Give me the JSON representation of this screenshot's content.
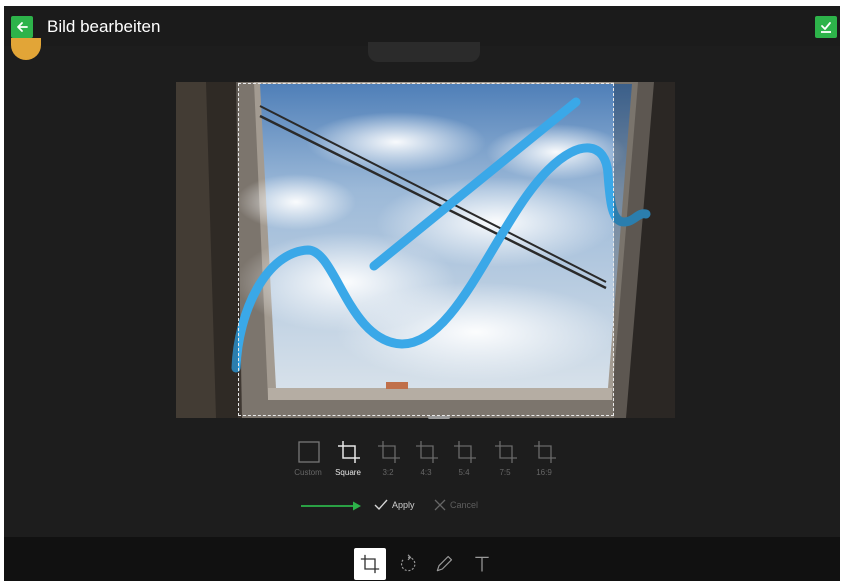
{
  "header": {
    "title": "Bild bearbeiten",
    "back_icon": "arrow-left-icon",
    "save_icon": "check-download-icon",
    "accent_color": "#2db34a"
  },
  "crop": {
    "ratios": [
      {
        "label": "Custom",
        "icon": "square-outline-icon",
        "active": false
      },
      {
        "label": "Square",
        "icon": "crop-icon",
        "active": true
      },
      {
        "label": "3:2",
        "icon": "crop-icon",
        "active": false
      },
      {
        "label": "4:3",
        "icon": "crop-icon",
        "active": false
      },
      {
        "label": "5:4",
        "icon": "crop-icon",
        "active": false
      },
      {
        "label": "7:5",
        "icon": "crop-icon",
        "active": false
      },
      {
        "label": "16:9",
        "icon": "crop-icon",
        "active": false
      }
    ],
    "apply_label": "Apply",
    "cancel_label": "Cancel"
  },
  "toolbar": {
    "tools": [
      {
        "name": "crop",
        "icon": "crop-icon",
        "active": true
      },
      {
        "name": "rotate",
        "icon": "rotate-icon",
        "active": false
      },
      {
        "name": "draw",
        "icon": "pencil-icon",
        "active": false
      },
      {
        "name": "text",
        "icon": "text-icon",
        "active": false
      }
    ]
  },
  "colors": {
    "background": "#1d1d1d",
    "toolbar": "#111111",
    "drawing_stroke": "#3aa8e8",
    "arrow": "#2db34a"
  }
}
